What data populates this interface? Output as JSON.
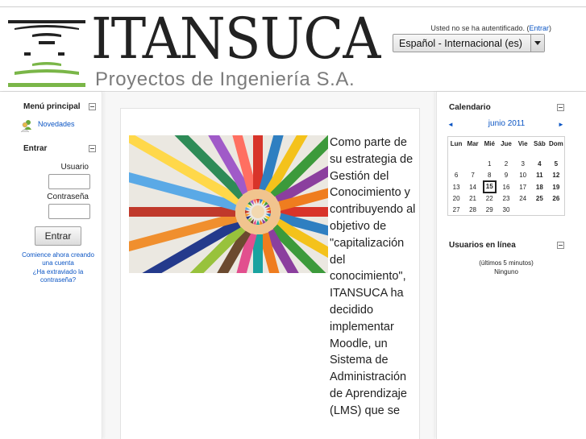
{
  "header": {
    "logo_title": "ITANSUCA",
    "logo_subtitle": "Proyectos de Ingeniería S.A.",
    "login_info_text": "Usted no se ha autentificado. (",
    "login_info_link": "Entrar",
    "login_info_end": ")",
    "language_selected": "Español - Internacional (es)"
  },
  "left": {
    "main_menu_title": "Menú principal",
    "news_link": "Novedades",
    "login_title": "Entrar",
    "username_label": "Usuario",
    "password_label": "Contraseña",
    "login_button": "Entrar",
    "signup_link": "Comience ahora creando una cuenta",
    "forgot_link": "¿Ha extraviado la contraseña?"
  },
  "main": {
    "text": "Como parte de su estrategia de Gestión del Conocimiento y contribuyendo al objetivo de \"capitalización del conocimiento\", ITANSUCA ha decidido implementar Moodle, un Sistema de Administración de Aprendizaje (LMS) que se"
  },
  "calendar": {
    "title": "Calendario",
    "prev": "◄",
    "month": "junio 2011",
    "next": "►",
    "days": [
      "Lun",
      "Mar",
      "Mié",
      "Jue",
      "Vie",
      "Sáb",
      "Dom"
    ],
    "weeks": [
      [
        "",
        "",
        "1",
        "2",
        "3",
        "4",
        "5"
      ],
      [
        "6",
        "7",
        "8",
        "9",
        "10",
        "11",
        "12"
      ],
      [
        "13",
        "14",
        "15",
        "16",
        "17",
        "18",
        "19"
      ],
      [
        "20",
        "21",
        "22",
        "23",
        "24",
        "25",
        "26"
      ],
      [
        "27",
        "28",
        "29",
        "30",
        "",
        "",
        ""
      ]
    ],
    "today": "15"
  },
  "online": {
    "title": "Usuarios en línea",
    "subtitle": "(últimos 5 minutos)",
    "none": "Ninguno"
  },
  "colors": {
    "link": "#0b55c4",
    "logo_green": "#7ab648",
    "logo_dark": "#222222"
  }
}
